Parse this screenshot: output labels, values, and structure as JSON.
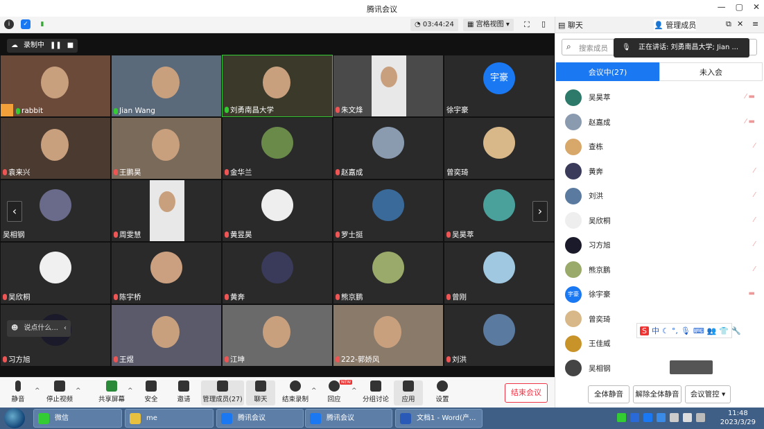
{
  "window": {
    "title": "腾讯会议",
    "min": "—",
    "max": "▢",
    "close": "✕"
  },
  "topbar": {
    "timer": "03:44:24",
    "view_label": "宫格视图"
  },
  "recording": {
    "label": "录制中"
  },
  "tiles": [
    {
      "name": "rabbit",
      "mic": "on",
      "avatar_color": "#f2a13a"
    },
    {
      "name": "Jian Wang",
      "mic": "on"
    },
    {
      "name": "刘勇南昌大学",
      "mic": "on"
    },
    {
      "name": "朱文烽",
      "mic": "off"
    },
    {
      "name": "徐宇豪",
      "mic": "none",
      "avatar_text": "宇豪",
      "avatar_color": "#1a78f2"
    },
    {
      "name": "袁来兴",
      "mic": "off"
    },
    {
      "name": "王鹏昊",
      "mic": "off"
    },
    {
      "name": "金华兰",
      "mic": "off"
    },
    {
      "name": "赵嘉成",
      "mic": "off"
    },
    {
      "name": "曾奕琦",
      "mic": "none"
    },
    {
      "name": "吴相钢",
      "mic": "none"
    },
    {
      "name": "周雯慧",
      "mic": "off"
    },
    {
      "name": "黄昱昊",
      "mic": "off"
    },
    {
      "name": "罗士挺",
      "mic": "off"
    },
    {
      "name": "吴昊萃",
      "mic": "off"
    },
    {
      "name": "吴欣桐",
      "mic": "off"
    },
    {
      "name": "陈宇桥",
      "mic": "off"
    },
    {
      "name": "黄奔",
      "mic": "off"
    },
    {
      "name": "熊京鹏",
      "mic": "off"
    },
    {
      "name": "曾刚",
      "mic": "off"
    },
    {
      "name": "习方旭",
      "mic": "off"
    },
    {
      "name": "王煜",
      "mic": "off"
    },
    {
      "name": "江坤",
      "mic": "off"
    },
    {
      "name": "222-郭娇风",
      "mic": "off"
    },
    {
      "name": "刘洪",
      "mic": "off"
    }
  ],
  "speak_prompt": "说点什么...",
  "toolbar": {
    "mute": "静音",
    "stop_video": "停止视频",
    "share": "共享屏幕",
    "security": "安全",
    "invite": "邀请",
    "members": "管理成员(27)",
    "chat": "聊天",
    "end_record": "结束录制",
    "react": "回应",
    "breakout": "分组讨论",
    "apps": "应用",
    "settings": "设置",
    "end_meeting": "结束会议",
    "new_badge": "NEW"
  },
  "panel": {
    "chat_tab": "聊天",
    "members_tab": "管理成员",
    "search_placeholder": "搜索成员",
    "speaking": "正在讲话: 刘勇南昌大学; Jian ...",
    "in_meeting": "会议中(27)",
    "not_joined": "未入会",
    "members": [
      {
        "name": "吴昊萃",
        "color": "#2d7a6a"
      },
      {
        "name": "赵嘉成",
        "color": "#8a9bb0"
      },
      {
        "name": "查栋",
        "color": "#d8a86a"
      },
      {
        "name": "黄奔",
        "color": "#3a3a5a"
      },
      {
        "name": "刘洪",
        "color": "#5a7aa0"
      },
      {
        "name": "吴欣桐",
        "color": "#eeeeee"
      },
      {
        "name": "习方旭",
        "color": "#1a1a2a"
      },
      {
        "name": "熊京鹏",
        "color": "#9aaa6a"
      },
      {
        "name": "徐宇豪",
        "color": "#1a78f2",
        "text": "宇豪"
      },
      {
        "name": "曾奕琦",
        "color": "#d8b888"
      },
      {
        "name": "王佳威",
        "color": "#c8942a"
      },
      {
        "name": "吴相钢",
        "color": "#444444"
      }
    ],
    "mute_all": "全体静音",
    "unmute_all": "解除全体静音",
    "control": "会议管控"
  },
  "taskbar": {
    "items": [
      "微信",
      "me",
      "腾讯会议",
      "腾讯会议",
      "文档1 - Word(产..."
    ],
    "time": "11:48",
    "date": "2023/3/29"
  }
}
